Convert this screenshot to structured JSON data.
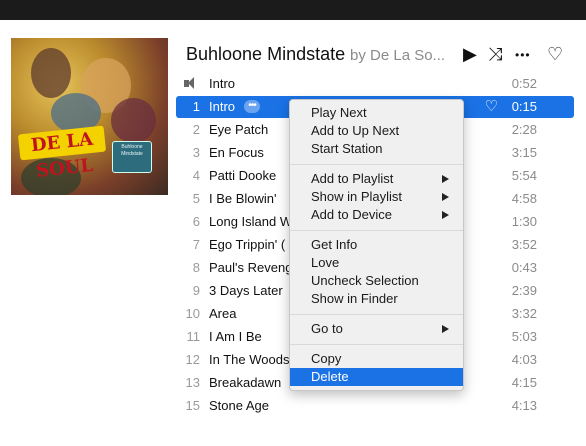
{
  "album": {
    "title": "Buhloone Mindstate",
    "artist_by": "by De La So..."
  },
  "album_art": {
    "logo_text": "DE LA SOUL",
    "sticker_text": "Buhloone Mindstate"
  },
  "header_icons": {
    "play": "▶",
    "shuffle": "⤨",
    "more": "•••",
    "love": "♡"
  },
  "tracks": [
    {
      "num": "",
      "title": "Intro",
      "duration": "0:52"
    },
    {
      "num": "1",
      "title": "Intro",
      "duration": "0:15"
    },
    {
      "num": "2",
      "title": "Eye Patch",
      "duration": "2:28"
    },
    {
      "num": "3",
      "title": "En Focus",
      "duration": "3:15"
    },
    {
      "num": "4",
      "title": "Patti Dooke",
      "duration": "5:54"
    },
    {
      "num": "5",
      "title": "I Be Blowin'",
      "duration": "4:58"
    },
    {
      "num": "6",
      "title": "Long Island W",
      "duration": "1:30"
    },
    {
      "num": "7",
      "title": "Ego Trippin' (",
      "duration": "3:52"
    },
    {
      "num": "8",
      "title": "Paul's Revenge",
      "duration": "0:43"
    },
    {
      "num": "9",
      "title": "3 Days Later",
      "duration": "2:39"
    },
    {
      "num": "10",
      "title": "Area",
      "duration": "3:32"
    },
    {
      "num": "11",
      "title": "I Am I Be",
      "duration": "5:03"
    },
    {
      "num": "12",
      "title": "In The Woods",
      "duration": "4:03"
    },
    {
      "num": "13",
      "title": "Breakadawn",
      "duration": "4:15"
    },
    {
      "num": "15",
      "title": "Stone Age",
      "duration": "4:13"
    }
  ],
  "selected_track_index": 1,
  "context_menu": {
    "items": [
      {
        "label": "Play Next"
      },
      {
        "label": "Add to Up Next"
      },
      {
        "label": "Start Station"
      },
      {
        "label": "Add to Playlist"
      },
      {
        "label": "Show in Playlist"
      },
      {
        "label": "Add to Device"
      },
      {
        "label": "Get Info"
      },
      {
        "label": "Love"
      },
      {
        "label": "Uncheck Selection"
      },
      {
        "label": "Show in Finder"
      },
      {
        "label": "Go to"
      },
      {
        "label": "Copy"
      },
      {
        "label": "Delete"
      }
    ],
    "highlighted": "Delete"
  },
  "colors": {
    "selection": "#1a72e5",
    "topbar": "#1b1b1b"
  }
}
